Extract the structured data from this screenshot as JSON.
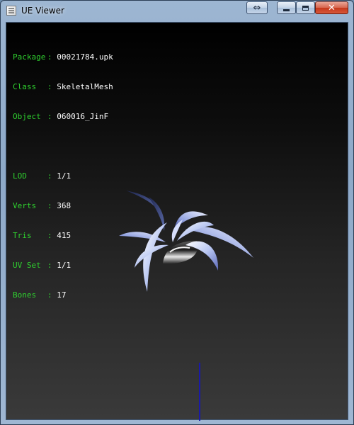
{
  "window": {
    "title": "UE Viewer"
  },
  "info": {
    "package": {
      "label": "Package",
      "value": "00021784.upk"
    },
    "class": {
      "label": "Class",
      "value": "SkeletalMesh"
    },
    "object": {
      "label": "Object",
      "value": "060016_JinF"
    },
    "lod": {
      "label": "LOD",
      "value": "1/1"
    },
    "verts": {
      "label": "Verts",
      "value": "368"
    },
    "tris": {
      "label": "Tris",
      "value": "415"
    },
    "uvset": {
      "label": "UV Set",
      "value": "1/1"
    },
    "bones": {
      "label": "Bones",
      "value": "17"
    }
  },
  "colors": {
    "label_green": "#2fd12f",
    "value_white": "#ffffff",
    "axis_blue": "#1a1aa8"
  },
  "icons": {
    "resize": "double-arrow-icon",
    "minimize": "minimize-icon",
    "maximize": "maximize-icon",
    "close": "close-icon"
  }
}
